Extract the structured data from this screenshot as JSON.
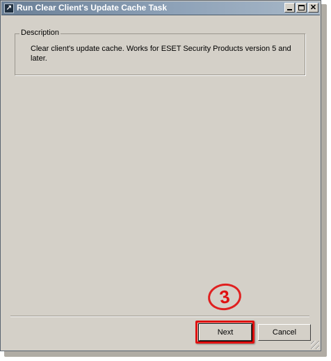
{
  "window": {
    "title": "Run Clear Client's Update Cache Task",
    "app_icon": "arrow-icon",
    "caption_buttons": [
      "minimize-icon",
      "maximize-icon",
      "close-icon"
    ]
  },
  "description_group": {
    "legend": "Description",
    "text": "Clear client's update cache. Works for ESET Security Products version 5 and later."
  },
  "footer": {
    "next_label": "Next",
    "cancel_label": "Cancel"
  },
  "annotation": {
    "step_number": "3",
    "color": "#e01010"
  }
}
